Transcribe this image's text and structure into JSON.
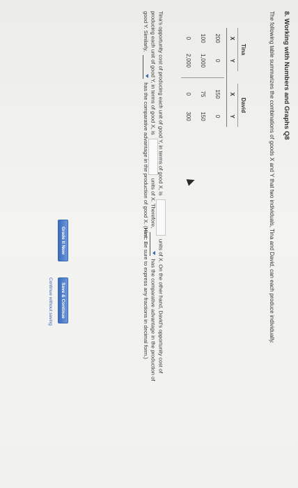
{
  "title": "8. Working with Numbers and Graphs Q8",
  "intro": "The following table summarizes the combinations of goods X and Y that two individuals, Tina and David, can each produce individually.",
  "table": {
    "groups": [
      "Tina",
      "David"
    ],
    "columns": [
      "X",
      "Y",
      "X",
      "Y"
    ],
    "rows": [
      [
        "200",
        "0",
        "150",
        "0"
      ],
      [
        "100",
        "1,000",
        "75",
        "150"
      ],
      [
        "0",
        "2,000",
        "0",
        "300"
      ]
    ]
  },
  "paragraph": {
    "line1_a": "Tina's opportunity cost of producing each unit of good Y, in terms of good X, is",
    "line1_b": "units of X. On the other hand, David's opportunity cost of",
    "line2_a": "producing each unit of good Y, in terms of good X, is",
    "line2_b": "units of X. Therefore,",
    "line2_c": "has the comparative advantage in the production of",
    "line3_a": "good Y. Similarly,",
    "line3_b": "has the comparative advantage in the production of good X. (",
    "line3_hint": "Hint:",
    "line3_c": " Be sure to express any fractions in decimal form.)"
  },
  "inputs": {
    "tina_cost_value": "",
    "david_cost_value": "",
    "advantage_y_selected": "",
    "advantage_x_selected": ""
  },
  "buttons": {
    "grade": "Grade It Now",
    "save": "Save & Continue",
    "continue": "Continue without saving"
  },
  "colors": {
    "button": "#3f6dbd",
    "link": "#3a64b0"
  }
}
